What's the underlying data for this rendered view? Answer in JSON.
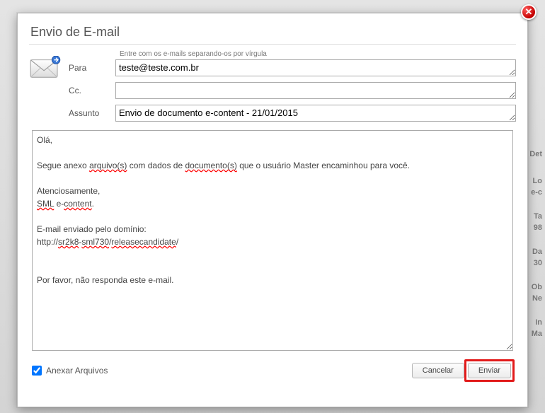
{
  "background": {
    "labels": [
      "Det",
      "Lo",
      "e-c",
      "Ta",
      "98",
      "Da",
      "30",
      "Ob",
      "Ne",
      "In",
      "Ma"
    ]
  },
  "dialog": {
    "title": "Envio de E-mail",
    "close_glyph": "✕",
    "hint": "Entre com os e-mails separando-os por vírgula",
    "fields": {
      "para_label": "Para",
      "para_value": "teste@teste.com.br",
      "cc_label": "Cc.",
      "cc_value": "",
      "assunto_label": "Assunto",
      "assunto_value": "Envio de documento e-content - 21/01/2015"
    },
    "body": {
      "greeting": "Olá,",
      "line1_a": "Segue anexo ",
      "line1_b": "arquivo(s)",
      "line1_c": " com dados de ",
      "line1_d": "documento(s)",
      "line1_e": " que o usuário Master encaminhou para você.",
      "att": "Atenciosamente,",
      "sig_a": "SML",
      "sig_b": " e-",
      "sig_c": "content",
      "sig_d": ".",
      "dom_label": "E-mail enviado pelo domínio:",
      "url_a": "http://",
      "url_b": "sr2k8",
      "url_c": "-",
      "url_d": "sml730",
      "url_e": "/",
      "url_f": "releasecandidate",
      "url_g": "/",
      "noreply": "Por favor, não responda este e-mail."
    },
    "footer": {
      "attach_label": "Anexar Arquivos",
      "attach_checked": true,
      "cancel_label": "Cancelar",
      "send_label": "Enviar"
    }
  }
}
